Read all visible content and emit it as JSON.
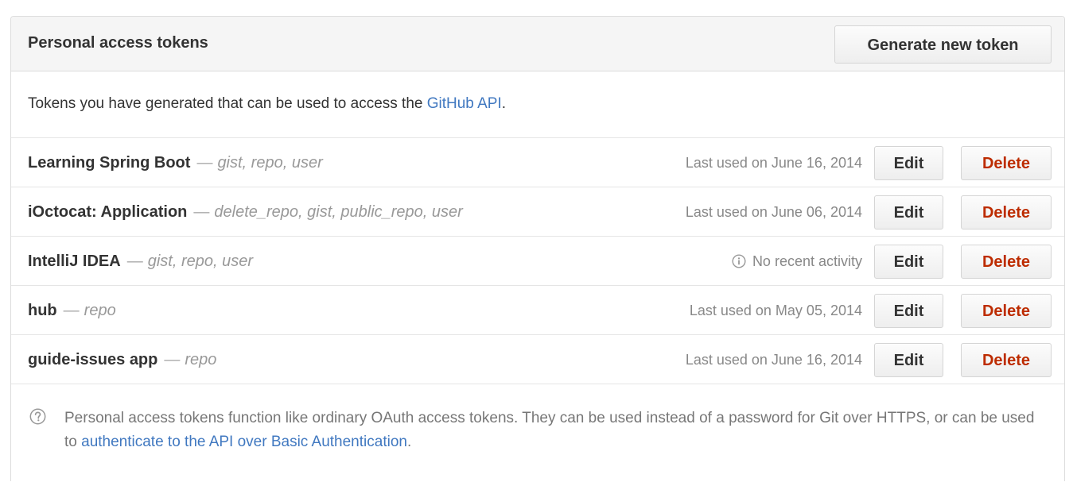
{
  "header": {
    "title": "Personal access tokens",
    "generate_label": "Generate new token"
  },
  "intro": {
    "text_before": "Tokens you have generated that can be used to access the ",
    "link_text": "GitHub API",
    "text_after": "."
  },
  "tokens": [
    {
      "name": "Learning Spring Boot",
      "dash": "—",
      "scopes": "gist, repo, user",
      "last_used": "Last used on June 16, 2014",
      "has_info_icon": false,
      "edit_label": "Edit",
      "delete_label": "Delete"
    },
    {
      "name": "iOctocat: Application",
      "dash": "—",
      "scopes": "delete_repo, gist, public_repo, user",
      "last_used": "Last used on June 06, 2014",
      "has_info_icon": false,
      "edit_label": "Edit",
      "delete_label": "Delete"
    },
    {
      "name": "IntelliJ IDEA",
      "dash": "—",
      "scopes": "gist, repo, user",
      "last_used": "No recent activity",
      "has_info_icon": true,
      "edit_label": "Edit",
      "delete_label": "Delete"
    },
    {
      "name": "hub",
      "dash": "—",
      "scopes": "repo",
      "last_used": "Last used on May 05, 2014",
      "has_info_icon": false,
      "edit_label": "Edit",
      "delete_label": "Delete"
    },
    {
      "name": "guide-issues app",
      "dash": "—",
      "scopes": "repo",
      "last_used": "Last used on June 16, 2014",
      "has_info_icon": false,
      "edit_label": "Edit",
      "delete_label": "Delete"
    }
  ],
  "footer": {
    "text_before": "Personal access tokens function like ordinary OAuth access tokens. They can be used instead of a password for Git over HTTPS, or can be used to ",
    "link_text": "authenticate to the API over Basic Authentication",
    "text_after": "."
  },
  "icons": {
    "info": "info-circle-icon",
    "help": "question-circle-icon"
  },
  "colors": {
    "link": "#4078c0",
    "danger": "#bd2c00",
    "header_bg": "#f5f5f5",
    "border": "#dddddd",
    "muted": "#888888"
  }
}
